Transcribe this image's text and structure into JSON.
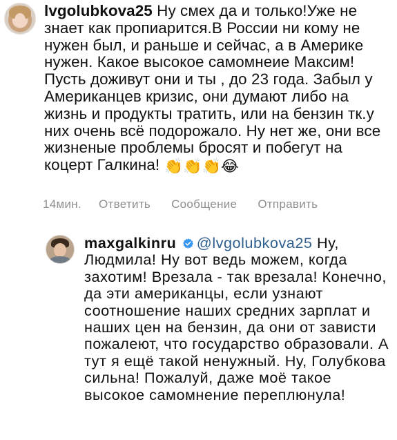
{
  "main_comment": {
    "username": "lvgolubkova25",
    "text": "Ну смех да и только!Уже не знает как пропиарится.В России ни кому не нужен был, и раньше и сейчас, а в Америке нужен. Какое высокое самомнеие Максим! Пусть доживут они и ты , до 23 года.  Забыл у Американцев кризис, они думают либо на жизнь и продукты тратить, или на бензин тк.у них очень всё  подорожало. Ну нет же, они все жизненые проблемы бросят и побегут на коцерт Галкина!",
    "emojis": [
      "👏",
      "👏",
      "👏",
      "😂"
    ],
    "avatar_icon": "user-avatar-lvgolubkova25"
  },
  "actions": {
    "time": "14мин.",
    "reply": "Ответить",
    "message": "Сообщение",
    "send": "Отправить"
  },
  "reply_comment": {
    "username": "maxgalkinru",
    "verified_icon": "verified-badge-icon",
    "mention": "@lvgolubkova25",
    "text": "Ну, Людмила! Ну вот ведь можем, когда захотим! Врезала - так врезала! Конечно, да эти американцы, если узнают соотношение наших средних зарплат и наших цен на бензин, да они от зависти пожалеют, что государство образовали. А тут я ещё такой ненужный. Ну, Голубкова сильна! Пожалуй, даже моё такое высокое самомнение переплюнула!",
    "avatar_icon": "user-avatar-maxgalkinru"
  },
  "colors": {
    "text": "#111111",
    "meta": "#8e8e8e",
    "mention": "#2f5f8f",
    "verified": "#3897f0",
    "background": "#ffffff"
  }
}
